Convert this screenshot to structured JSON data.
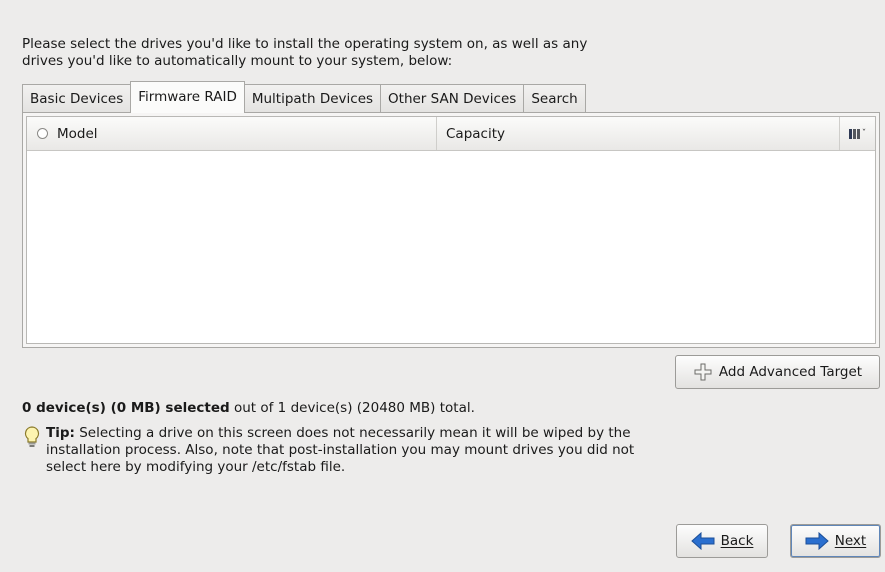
{
  "intro": {
    "line1": "Please select the drives you'd like to install the operating system on, as well as any",
    "line2": "drives you'd like to automatically mount to your system, below:"
  },
  "tabs": [
    {
      "label": "Basic Devices",
      "active": false
    },
    {
      "label": "Firmware RAID",
      "active": true
    },
    {
      "label": "Multipath Devices",
      "active": false
    },
    {
      "label": "Other SAN Devices",
      "active": false
    },
    {
      "label": "Search",
      "active": false
    }
  ],
  "table": {
    "columns": {
      "model": "Model",
      "capacity": "Capacity"
    },
    "rows": []
  },
  "buttons": {
    "add_target": "Add Advanced Target",
    "back": "Back",
    "next": "Next"
  },
  "status": {
    "selected": "0 device(s) (0 MB) selected",
    "total": " out of 1 device(s) (20480 MB) total."
  },
  "tip": {
    "label": "Tip:",
    "line1": " Selecting a drive on this screen does not necessarily mean it will be wiped by the",
    "line2": "installation process.  Also, note that post-installation you may mount drives you did not",
    "line3": "select here by modifying your /etc/fstab file."
  },
  "icons": {
    "add": "plus-icon",
    "back": "left-arrow-icon",
    "next": "right-arrow-icon",
    "tip": "lightbulb-icon",
    "columns": "column-chooser-icon"
  },
  "colors": {
    "background": "#edeceb",
    "arrow_blue": "#2a6fcf"
  }
}
